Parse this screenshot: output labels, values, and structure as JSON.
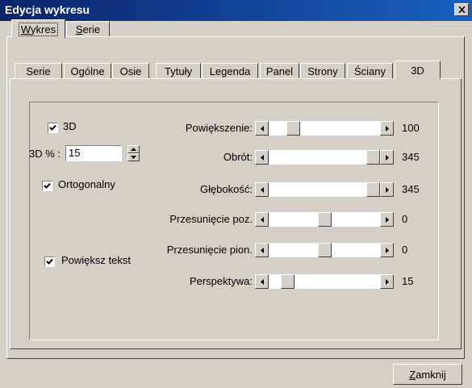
{
  "window": {
    "title": "Edycja wykresu"
  },
  "outer_tabs": [
    {
      "label": "Wykres",
      "underline": "W"
    },
    {
      "label": "Serie",
      "underline": "S"
    }
  ],
  "inner_tabs": [
    "Serie",
    "Ogólne",
    "Osie",
    "Tytuły",
    "Legenda",
    "Panel",
    "Strony",
    "Ściany",
    "3D"
  ],
  "options": {
    "checkbox_3d": {
      "label": "3D",
      "checked": true
    },
    "spinner_3d_percent": {
      "label": "3D % :",
      "value": "15"
    },
    "checkbox_orthogonal": {
      "label": "Ortogonalny",
      "checked": true
    },
    "checkbox_zoom_text": {
      "label": "Powiększ tekst",
      "checked": true
    }
  },
  "sliders": [
    {
      "label": "Powiększenie:",
      "value": "100",
      "position": 0.18
    },
    {
      "label": "Obrót:",
      "value": "345",
      "position": 1.0
    },
    {
      "label": "Głębokość:",
      "value": "345",
      "position": 1.0
    },
    {
      "label": "Przesunięcie poz.",
      "value": "0",
      "position": 0.5
    },
    {
      "label": "Przesunięcie pion.",
      "value": "0",
      "position": 0.5
    },
    {
      "label": "Perspektywa:",
      "value": "15",
      "position": 0.12
    }
  ],
  "footer": {
    "close_button": "Zamknij"
  }
}
